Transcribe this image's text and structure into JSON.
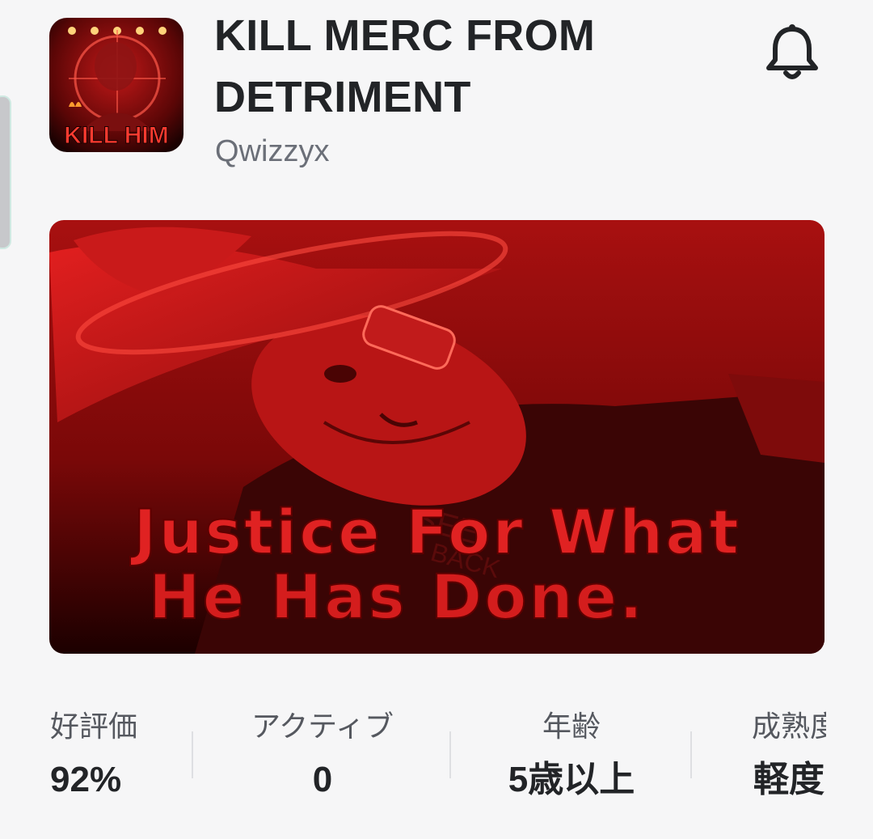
{
  "game": {
    "title": "KILL MERC FROM DETRIMENT",
    "creator": "Qwizzyx",
    "icon_text": "KILL HIM",
    "thumbnail_text_line1": "Justice For What",
    "thumbnail_text_line2": "He Has Done."
  },
  "header": {
    "notify_icon": "bell-icon"
  },
  "stats": [
    {
      "label": "好評価",
      "value": "92%"
    },
    {
      "label": "アクティブ",
      "value": "0"
    },
    {
      "label": "年齢",
      "value": "5歳以上"
    },
    {
      "label": "成熟度",
      "value": "軽度"
    }
  ],
  "colors": {
    "background": "#f6f6f7",
    "title": "#222427",
    "creator": "#6b6f78",
    "thumbnail_red": "#d81a1a"
  }
}
